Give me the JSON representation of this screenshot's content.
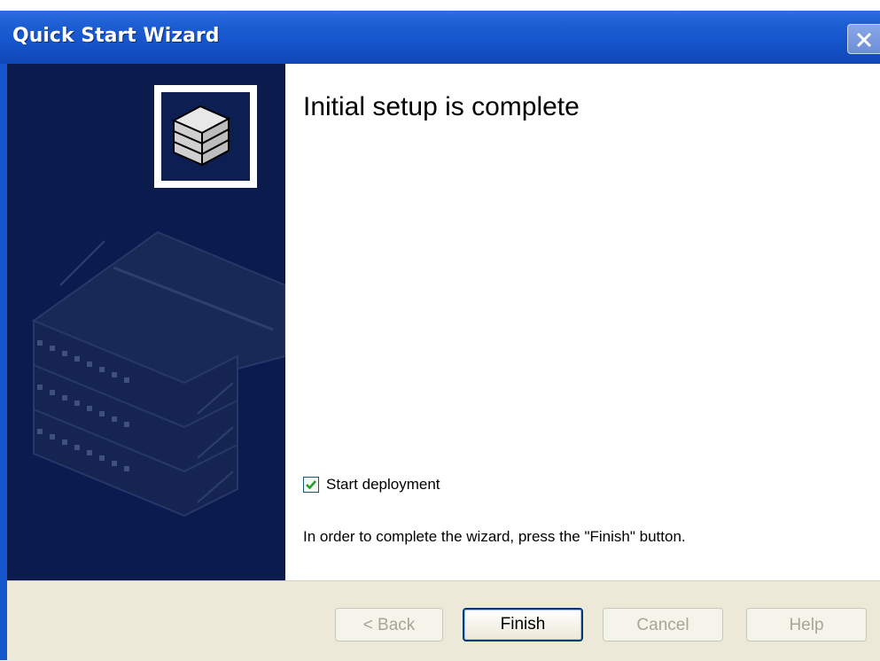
{
  "window": {
    "title": "Quick Start Wizard",
    "close_icon": "close-icon"
  },
  "main": {
    "heading": "Initial setup is complete",
    "checkbox": {
      "label": "Start deployment",
      "checked": true
    },
    "instruction": "In order to complete the wizard, press the \"Finish\" button."
  },
  "buttons": {
    "back": "< Back",
    "finish": "Finish",
    "cancel": "Cancel",
    "help": "Help"
  },
  "colors": {
    "title_bar": "#1656cc",
    "left_panel": "#0b1b4d",
    "button_bar": "#ece9d8"
  }
}
